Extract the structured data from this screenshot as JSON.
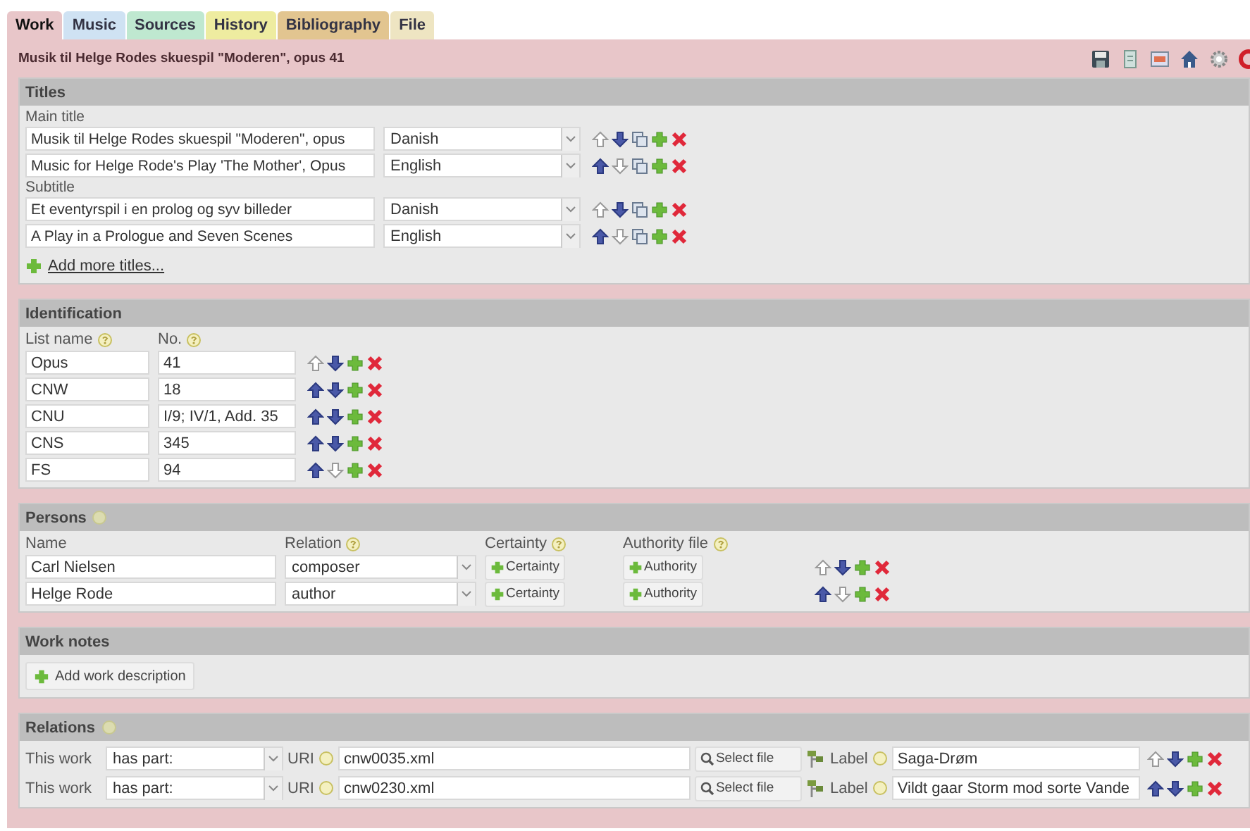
{
  "tabs": [
    {
      "label": "Work",
      "selected": true,
      "color": "#e8c6c9"
    },
    {
      "label": "Music",
      "selected": false,
      "color": "#cfe2f3"
    },
    {
      "label": "Sources",
      "selected": false,
      "color": "#bfe8d0"
    },
    {
      "label": "History",
      "selected": false,
      "color": "#eeeca0"
    },
    {
      "label": "Bibliography",
      "selected": false,
      "color": "#e2c590"
    },
    {
      "label": "File",
      "selected": false,
      "color": "#eee5c2"
    }
  ],
  "header": {
    "title": "Musik til Helge Rodes skuespil \"Moderen\", opus 41"
  },
  "titles": {
    "heading": "Titles",
    "groups": [
      {
        "label": "Main title",
        "rows": [
          {
            "value": "Musik til Helge Rodes skuespil \"Moderen\", opus",
            "language": "Danish",
            "up_disabled": true,
            "down_disabled": false
          },
          {
            "value": "Music for Helge Rode's Play 'The Mother', Opus",
            "language": "English",
            "up_disabled": false,
            "down_disabled": true
          }
        ]
      },
      {
        "label": "Subtitle",
        "rows": [
          {
            "value": "Et eventyrspil i en prolog og syv billeder",
            "language": "Danish",
            "up_disabled": true,
            "down_disabled": false
          },
          {
            "value": "A Play in a Prologue and Seven Scenes",
            "language": "English",
            "up_disabled": false,
            "down_disabled": true
          }
        ]
      }
    ],
    "add_link": "Add more titles..."
  },
  "identification": {
    "heading": "Identification",
    "columns": [
      {
        "text": "List name",
        "help": true
      },
      {
        "text": "No.",
        "help": true
      }
    ],
    "rows": [
      {
        "list_name": "Opus",
        "number": "41",
        "up_disabled": true,
        "down_disabled": false
      },
      {
        "list_name": "CNW",
        "number": "18",
        "up_disabled": false,
        "down_disabled": false
      },
      {
        "list_name": "CNU",
        "number": "I/9; IV/1, Add. 35",
        "up_disabled": false,
        "down_disabled": false
      },
      {
        "list_name": "CNS",
        "number": "345",
        "up_disabled": false,
        "down_disabled": false
      },
      {
        "list_name": "FS",
        "number": "94",
        "up_disabled": false,
        "down_disabled": true
      }
    ]
  },
  "persons": {
    "heading": "Persons",
    "help": true,
    "columns": [
      {
        "text": "Name"
      },
      {
        "text": "Relation",
        "help": true
      },
      {
        "text": "Certainty",
        "help": true
      },
      {
        "text": "Authority file",
        "help": true
      }
    ],
    "rows": [
      {
        "name": "Carl Nielsen",
        "relation": "composer",
        "certainty": "Certainty",
        "authority": "Authority",
        "up_disabled": true,
        "down_disabled": false
      },
      {
        "name": "Helge Rode",
        "relation": "author",
        "certainty": "Certainty",
        "authority": "Authority",
        "up_disabled": false,
        "down_disabled": true
      }
    ]
  },
  "work_notes": {
    "heading": "Work notes",
    "button": "Add work description"
  },
  "relations": {
    "heading": "Relations",
    "help": true,
    "rows": [
      {
        "subject": "This work",
        "relation": "has part:",
        "uri_label": "URI",
        "uri": "cnw0035.xml",
        "select": "Select file",
        "label_label": "Label",
        "label": "Saga-Drøm",
        "up_disabled": true,
        "down_disabled": false
      },
      {
        "subject": "This work",
        "relation": "has part:",
        "uri_label": "URI",
        "uri": "cnw0230.xml",
        "select": "Select file",
        "label_label": "Label",
        "label": "Vildt gaar Storm mod sorte Vande",
        "up_disabled": false,
        "down_disabled": false
      }
    ]
  }
}
